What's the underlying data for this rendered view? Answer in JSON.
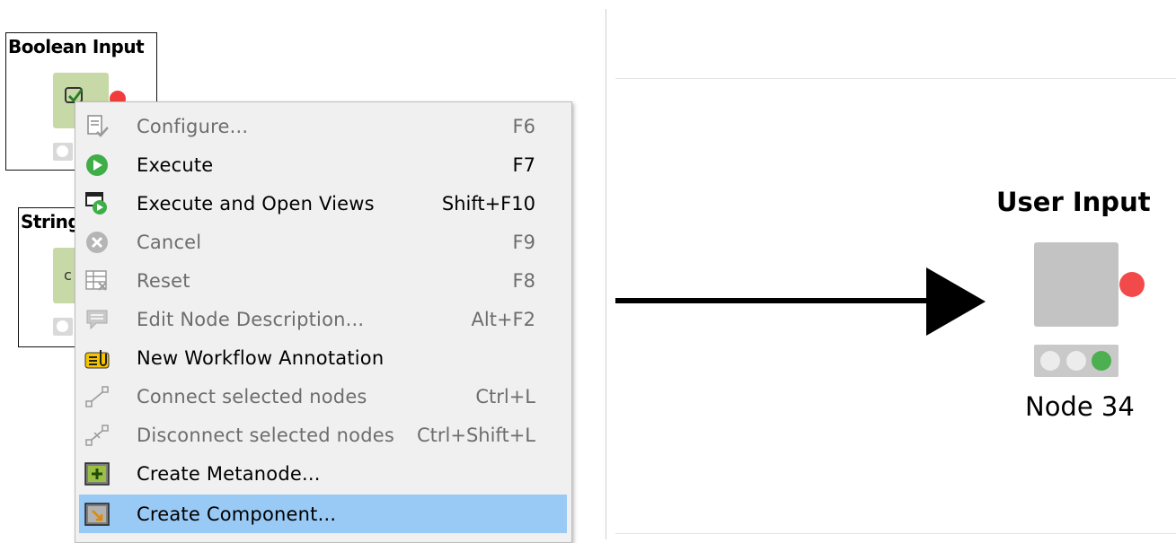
{
  "canvas": {
    "nodes": [
      {
        "title": "Boolean Input"
      },
      {
        "title": "String"
      }
    ]
  },
  "context_menu": {
    "items": [
      {
        "label": "Configure...",
        "shortcut": "F6",
        "enabled": false,
        "icon": "configure-icon"
      },
      {
        "label": "Execute",
        "shortcut": "F7",
        "enabled": true,
        "icon": "execute-icon"
      },
      {
        "label": "Execute and Open Views",
        "shortcut": "Shift+F10",
        "enabled": true,
        "icon": "execute-open-views-icon"
      },
      {
        "label": "Cancel",
        "shortcut": "F9",
        "enabled": false,
        "icon": "cancel-icon"
      },
      {
        "label": "Reset",
        "shortcut": "F8",
        "enabled": false,
        "icon": "reset-icon"
      },
      {
        "label": "Edit Node Description...",
        "shortcut": "Alt+F2",
        "enabled": false,
        "icon": "edit-description-icon"
      },
      {
        "label": "New Workflow Annotation",
        "shortcut": "",
        "enabled": true,
        "icon": "annotation-icon"
      },
      {
        "label": "Connect selected nodes",
        "shortcut": "Ctrl+L",
        "enabled": false,
        "icon": "connect-nodes-icon"
      },
      {
        "label": "Disconnect selected nodes",
        "shortcut": "Ctrl+Shift+L",
        "enabled": false,
        "icon": "disconnect-nodes-icon"
      },
      {
        "label": "Create Metanode...",
        "shortcut": "",
        "enabled": true,
        "icon": "create-metanode-icon"
      },
      {
        "label": "Create Component...",
        "shortcut": "",
        "enabled": true,
        "highlighted": true,
        "icon": "create-component-icon"
      }
    ]
  },
  "result_node": {
    "title": "User Input",
    "label": "Node 34",
    "status_colors": [
      "#e8e8e8",
      "#e8e8e8",
      "#4caf50"
    ],
    "port_color": "#f24a4a"
  }
}
